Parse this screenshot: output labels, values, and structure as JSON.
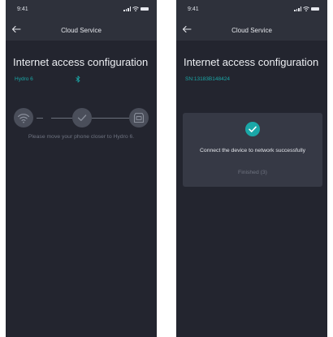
{
  "colors": {
    "screen_background": "#23252f",
    "header_background": "#2e313b",
    "accent_teal": "#1aa7a7",
    "card_background": "#363945",
    "step_circle": "#4a4e5a",
    "muted_text": "#6e7380"
  },
  "left_screen": {
    "status_bar": {
      "time": "9:41",
      "icons": [
        "signal-icon",
        "wifi-icon",
        "battery-icon"
      ]
    },
    "nav": {
      "back_icon": "back-arrow-icon",
      "title": "Cloud Service"
    },
    "heading": "Internet access configuration",
    "device_name": "Hydro 6",
    "bluetooth_icon": "bluetooth-icon",
    "steps": [
      {
        "icon": "wifi-icon",
        "state": "pending"
      },
      {
        "icon": "check-icon",
        "state": "pending"
      },
      {
        "icon": "device-icon",
        "state": "pending"
      }
    ],
    "hint": "Please move your phone closer to Hydro 6."
  },
  "right_screen": {
    "status_bar": {
      "time": "9:41",
      "icons": [
        "signal-icon",
        "wifi-icon",
        "battery-icon"
      ]
    },
    "nav": {
      "back_icon": "back-arrow-icon",
      "title": "Cloud Service"
    },
    "heading": "Internet access configuration",
    "serial": "SN:13183B148424",
    "card": {
      "icon": "success-check-icon",
      "message": "Connect the device to network successfully",
      "button_label": "Finished (3)"
    }
  }
}
